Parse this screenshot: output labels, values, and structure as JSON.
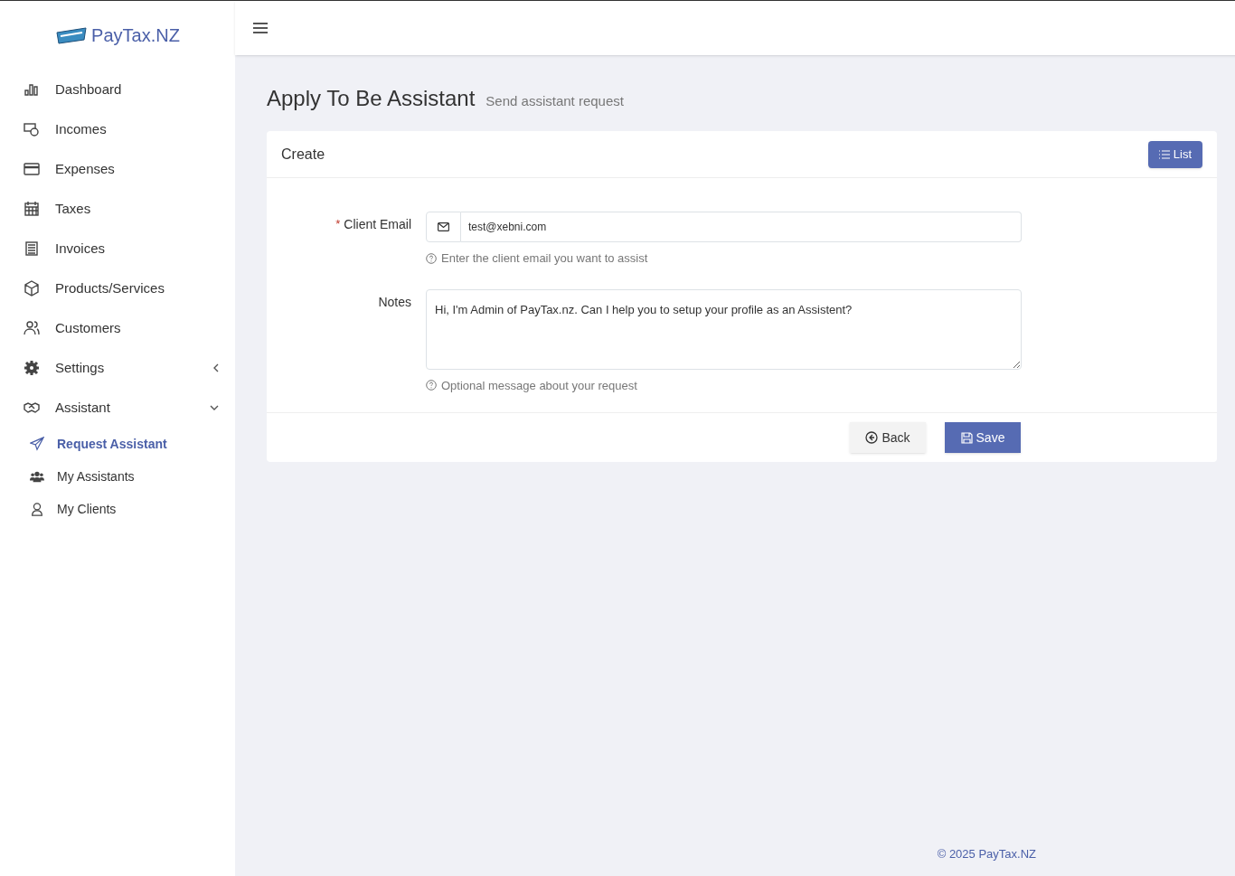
{
  "brand": {
    "name": "PayTax.NZ"
  },
  "sidebar": {
    "items": [
      {
        "label": "Dashboard",
        "kind": "chart",
        "selected": false
      },
      {
        "label": "Incomes",
        "kind": "money",
        "selected": false
      },
      {
        "label": "Expenses",
        "kind": "card",
        "selected": false
      },
      {
        "label": "Taxes",
        "kind": "calendar",
        "selected": false
      },
      {
        "label": "Invoices",
        "kind": "doc",
        "selected": false
      },
      {
        "label": "Products/Services",
        "kind": "box",
        "selected": false
      },
      {
        "label": "Customers",
        "kind": "users",
        "selected": false
      },
      {
        "label": "Settings",
        "kind": "gear",
        "selected": false,
        "expanded": false
      },
      {
        "label": "Assistant",
        "kind": "handshake",
        "selected": false,
        "expanded": true,
        "children": [
          {
            "label": "Request Assistant",
            "kind": "send",
            "selected": true
          },
          {
            "label": "My Assistants",
            "kind": "group",
            "selected": false
          },
          {
            "label": "My Clients",
            "kind": "user",
            "selected": false
          }
        ]
      }
    ]
  },
  "page": {
    "title": "Apply To Be Assistant",
    "subtitle": "Send assistant request"
  },
  "card": {
    "title": "Create",
    "list_button": "List",
    "fields": [
      {
        "kind": "email",
        "label": "Client Email",
        "required_mark": "*",
        "value": "test@xebni.com",
        "help": "Enter the client email you want to assist"
      },
      {
        "kind": "textarea",
        "label": "Notes",
        "value": "Hi, I'm Admin of PayTax.nz. Can I help you to setup your profile as an Assistent?",
        "help": "Optional message about your request"
      }
    ],
    "back_button": "Back",
    "save_button": "Save"
  },
  "footer": "© 2025 PayTax.NZ"
}
